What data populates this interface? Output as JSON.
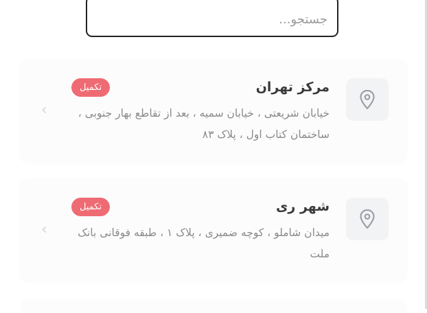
{
  "search": {
    "placeholder": "جستجو..."
  },
  "locations": [
    {
      "title": "مرکز تهران",
      "address": "خیابان شریعتی ، خیابان سمیه ، بعد از تقاطع بهار جنوبی ، ساختمان کتاب اول ، پلاک ۸۳",
      "badge": "تکمیل"
    },
    {
      "title": "شهر ری",
      "address": "میدان شاملو ، کوچه ضمیری ، پلاک ۱ ، طبقه فوقانی بانک ملت",
      "badge": "تکمیل"
    }
  ],
  "icons": {
    "pin": "map-pin-icon",
    "chevron": "chevron-left-icon"
  },
  "colors": {
    "badge": "#ef6b73",
    "pin": "#9aa0a6"
  }
}
